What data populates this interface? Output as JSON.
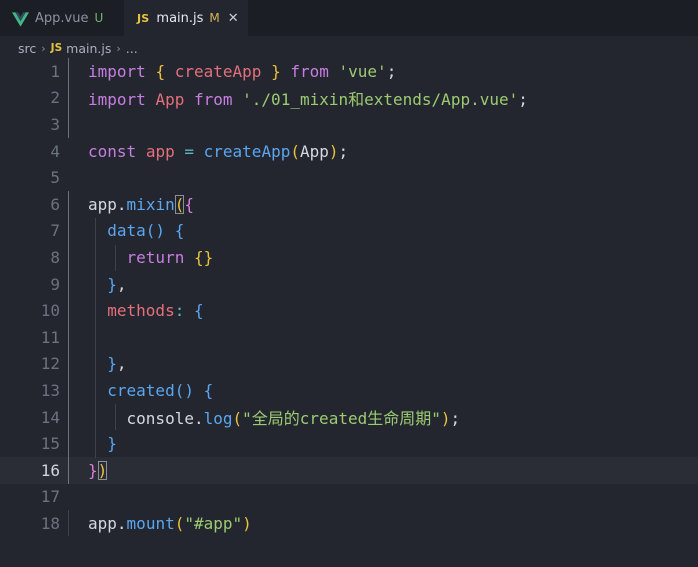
{
  "tabs": [
    {
      "label": "App.vue",
      "status": "U",
      "icon": "vue-icon"
    },
    {
      "label": "main.js",
      "status": "M",
      "icon": "js-icon",
      "close": "✕"
    }
  ],
  "breadcrumb": {
    "root": "src",
    "file_icon": "JS",
    "file": "main.js",
    "more": "..."
  },
  "editor": {
    "line_numbers": [
      "1",
      "2",
      "3",
      "4",
      "5",
      "6",
      "7",
      "8",
      "9",
      "10",
      "11",
      "12",
      "13",
      "14",
      "15",
      "16",
      "17",
      "18"
    ],
    "current_line": "16",
    "lines": [
      "import { createApp } from 'vue';",
      "import App from './01_mixin和extends/App.vue';",
      "",
      "const app = createApp(App);",
      "",
      "app.mixin({",
      "  data() {",
      "    return {}",
      "  },",
      "  methods: {",
      "",
      "  },",
      "  created() {",
      "    console.log(\"全局的created生命周期\");",
      "  }",
      "})",
      "",
      "app.mount(\"#app\")"
    ]
  },
  "colors": {
    "background": "#23262f",
    "keyword": "#c67ee0",
    "function": "#5aa6f0",
    "string": "#9ccb72",
    "variable": "#e4707a",
    "bracket": "#e8c33c"
  }
}
